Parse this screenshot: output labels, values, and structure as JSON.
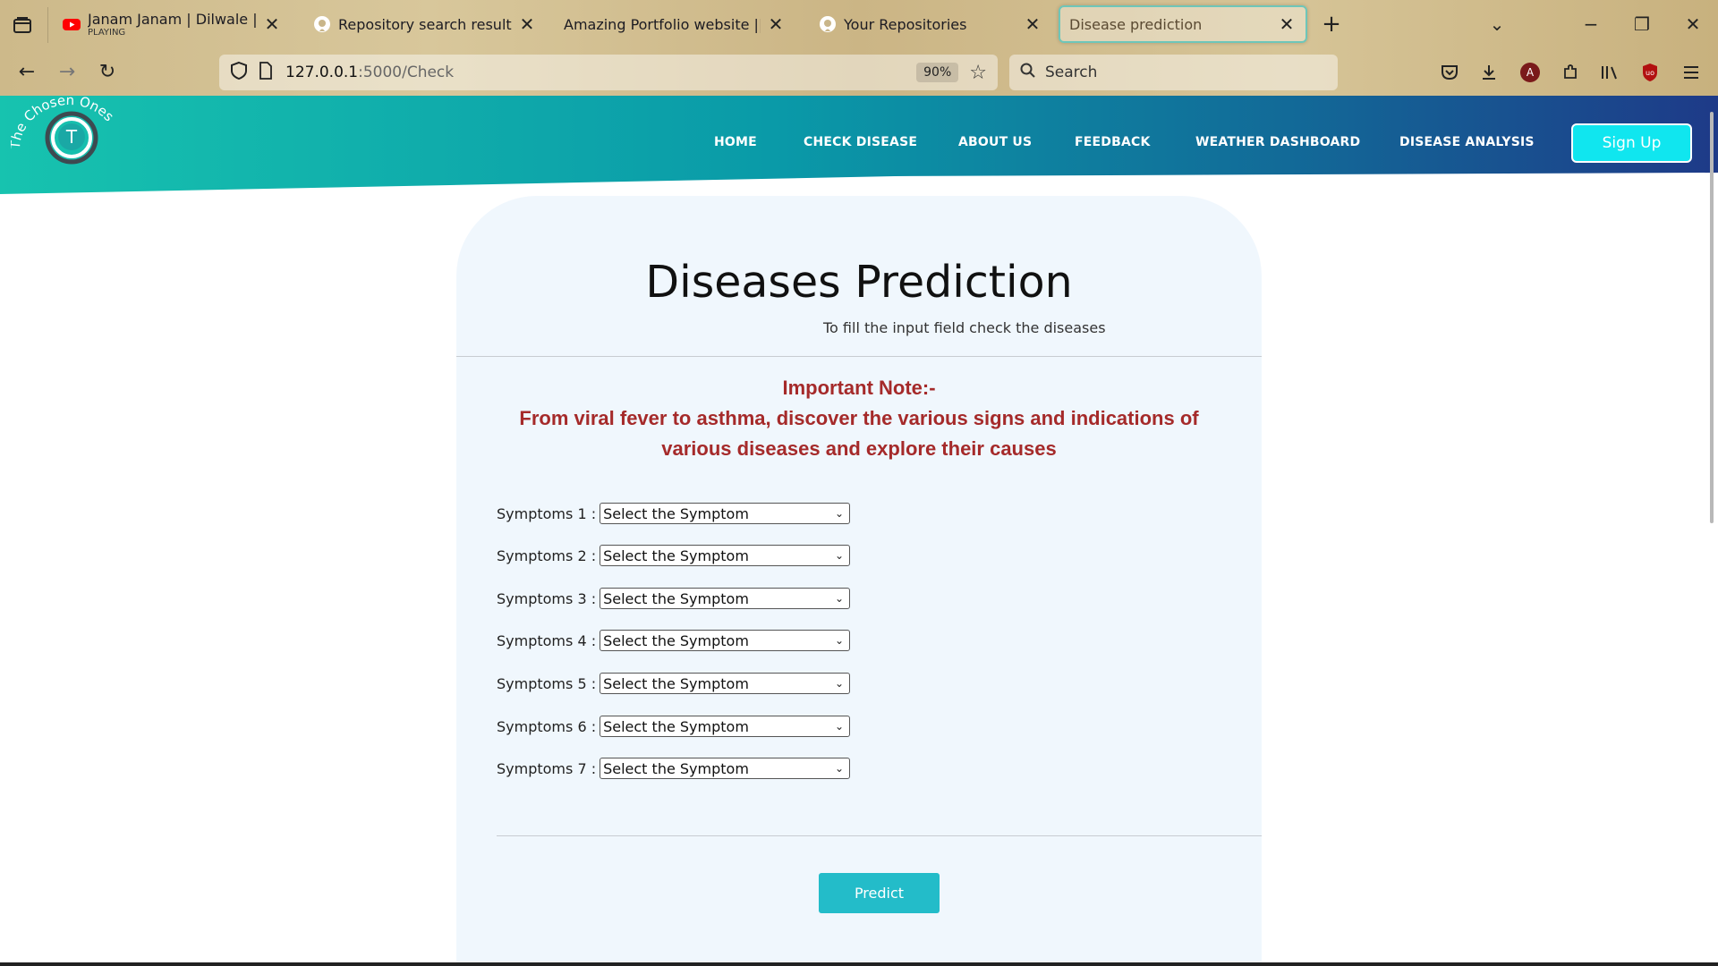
{
  "browser": {
    "tabs": [
      {
        "title": "Janam Janam | Dilwale | Slowed",
        "sub": "PLAYING",
        "icon": "youtube-icon"
      },
      {
        "title": "Repository search results",
        "icon": "github-icon"
      },
      {
        "title": "Amazing Portfolio website || Web A",
        "icon": ""
      },
      {
        "title": "Your Repositories",
        "icon": "github-icon"
      },
      {
        "title": "Disease prediction",
        "icon": "",
        "active": true
      }
    ],
    "url_host": "127.0.0.1",
    "url_path": ":5000/Check",
    "zoom": "90%",
    "search_placeholder": "Search",
    "profile_initial": "A"
  },
  "site": {
    "logo_text": "The Chosen Ones",
    "logo_letter": "T",
    "nav": [
      "HOME",
      "CHECK DISEASE",
      "ABOUT US",
      "FEEDBACK",
      "WEATHER DASHBOARD",
      "DISEASE ANALYSIS"
    ],
    "signup_label": "Sign Up"
  },
  "main": {
    "title": "Diseases Prediction",
    "subtitle": "To fill the input field check the diseases",
    "note_heading": "Important Note:-",
    "note_body_line1": "From viral fever to asthma, discover the various signs and indications of",
    "note_body_line2": "various diseases and explore their causes",
    "symptoms": [
      {
        "label": "Symptoms 1 :",
        "value": "Select the Symptom"
      },
      {
        "label": "Symptoms 2 :",
        "value": "Select the Symptom"
      },
      {
        "label": "Symptoms 3 :",
        "value": "Select the Symptom"
      },
      {
        "label": "Symptoms 4 :",
        "value": "Select the Symptom"
      },
      {
        "label": "Symptoms 5 :",
        "value": "Select the Symptom"
      },
      {
        "label": "Symptoms 6 :",
        "value": "Select the Symptom"
      },
      {
        "label": "Symptoms 7 :",
        "value": "Select the Symptom"
      }
    ],
    "predict_label": "Predict"
  },
  "colors": {
    "header_start": "#16c0b0",
    "header_end": "#1d3f8a",
    "note_red": "#a52a2a",
    "button_teal": "#23bcc9",
    "signup_cyan": "#10e6ef"
  }
}
